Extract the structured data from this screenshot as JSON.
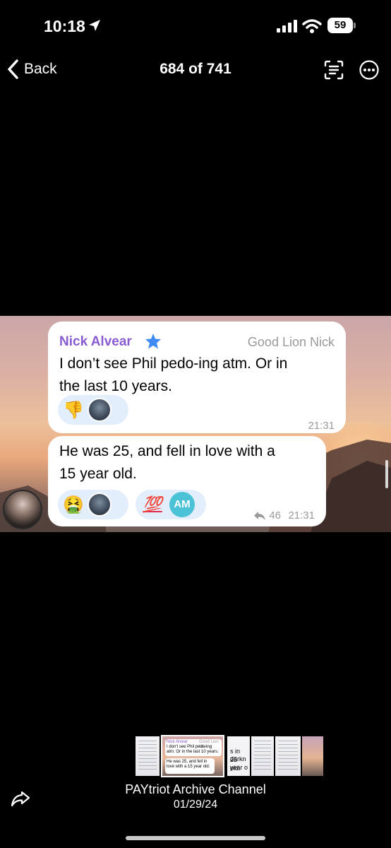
{
  "status_bar": {
    "time": "10:18",
    "battery": "59",
    "icons": [
      "location-arrow-icon",
      "signal-icon",
      "wifi-icon",
      "battery-icon"
    ]
  },
  "nav": {
    "back_label": "Back",
    "title": "684 of 741",
    "icons": [
      "chevron-left-icon",
      "text-scan-icon",
      "more-icon"
    ]
  },
  "messages": [
    {
      "sender": "Nick Alvear",
      "sender_badge": "star-icon",
      "sender_color": "#8a5cd1",
      "tag": "Good Lion Nick",
      "line1": "I don’t see Phil pedo-ing atm. Or in",
      "line2": "the last 10 years.",
      "reactions": [
        "👎"
      ],
      "time": "21:31"
    },
    {
      "line1": "He was 25, and fell in love with a",
      "line2": "15 year old.",
      "reactions": [
        "🤮",
        "💯"
      ],
      "reaction_initials": "AM",
      "forwards": "46",
      "time": "21:31"
    }
  ],
  "thumbnail_texts": {
    "t1_name": "Nick Alvear",
    "t1_tag": "Good Lion Nick",
    "t1_line": "I don't see Phil pedo-ing atm. Or in the last 10 years.",
    "t2_line": "He was 25, and fell in love with a 15 year old.",
    "t3_line1": "s in darkn",
    "t3_line2": "25 year o",
    "t3_line3": "old."
  },
  "caption": {
    "title": "PAYtriot Archive Channel",
    "date": "01/29/24"
  },
  "colors": {
    "background": "#000000",
    "bubble": "#ffffff",
    "reaction_pill": "#e2eefb",
    "am_avatar": "#4cc2d6"
  }
}
